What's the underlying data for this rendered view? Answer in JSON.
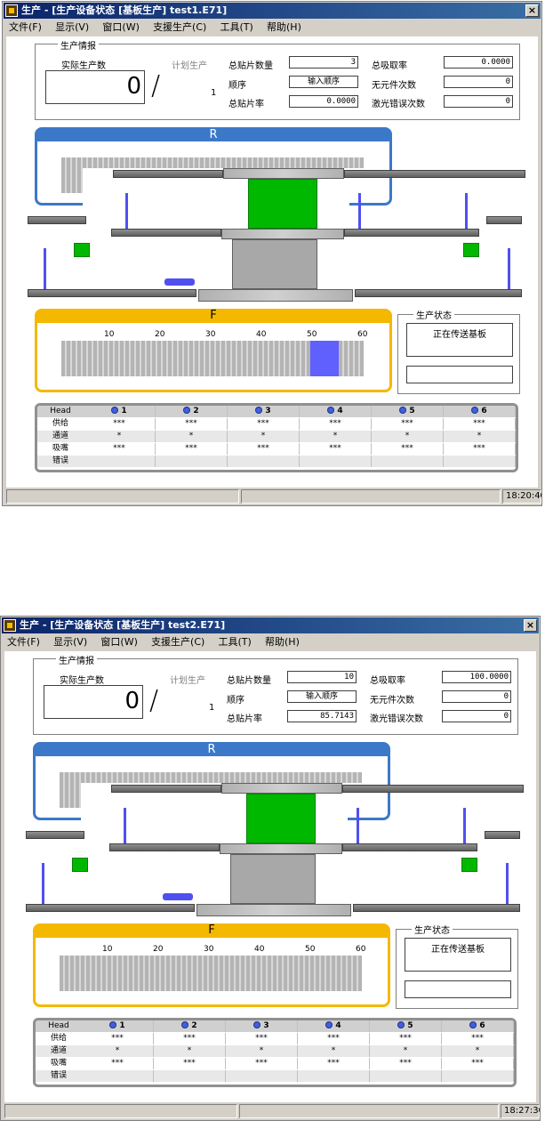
{
  "windows": [
    {
      "title": "生产 - [生产设备状态 [基板生产] test1.E71]",
      "menu": [
        "文件(F)",
        "显示(V)",
        "窗口(W)",
        "支援生产(C)",
        "工具(T)",
        "帮助(H)"
      ],
      "production_info": {
        "group_label": "生产情报",
        "actual_label": "实际生产数",
        "actual_value": "0",
        "plan_label": "计划生产",
        "plan_value": "1",
        "total_mount_label": "总贴片数量",
        "total_mount_value": "3",
        "order_label": "顺序",
        "order_button": "输入顺序",
        "total_rate_label": "总贴片率",
        "total_rate_value": "0.0000",
        "pickup_rate_label": "总吸取率",
        "pickup_rate_value": "0.0000",
        "no_part_label": "无元件次数",
        "no_part_value": "0",
        "laser_err_label": "激光错误次数",
        "laser_err_value": "0"
      },
      "r_panel": {
        "label": "R"
      },
      "f_panel": {
        "label": "F",
        "ticks": [
          "10",
          "20",
          "30",
          "40",
          "50",
          "60"
        ],
        "highlight": "51-54"
      },
      "status": {
        "group_label": "生产状态",
        "message": "正在传送基板"
      },
      "heads": {
        "header": "Head",
        "columns": [
          "1",
          "2",
          "3",
          "4",
          "5",
          "6"
        ],
        "rows": [
          {
            "label": "供给",
            "values": [
              "***",
              "***",
              "***",
              "***",
              "***",
              "***"
            ]
          },
          {
            "label": "通道",
            "values": [
              "*",
              "*",
              "*",
              "*",
              "*",
              "*"
            ]
          },
          {
            "label": "吸嘴",
            "values": [
              "***",
              "***",
              "***",
              "***",
              "***",
              "***"
            ]
          },
          {
            "label": "错误",
            "values": [
              "",
              "",
              "",
              "",
              "",
              ""
            ]
          }
        ]
      },
      "statusbar_time": "18:20:40"
    },
    {
      "title": "生产 - [生产设备状态 [基板生产] test2.E71]",
      "menu": [
        "文件(F)",
        "显示(V)",
        "窗口(W)",
        "支援生产(C)",
        "工具(T)",
        "帮助(H)"
      ],
      "production_info": {
        "group_label": "生产情报",
        "actual_label": "实际生产数",
        "actual_value": "0",
        "plan_label": "计划生产",
        "plan_value": "1",
        "total_mount_label": "总贴片数量",
        "total_mount_value": "10",
        "order_label": "顺序",
        "order_button": "输入顺序",
        "total_rate_label": "总贴片率",
        "total_rate_value": "85.7143",
        "pickup_rate_label": "总吸取率",
        "pickup_rate_value": "100.0000",
        "no_part_label": "无元件次数",
        "no_part_value": "0",
        "laser_err_label": "激光错误次数",
        "laser_err_value": "0"
      },
      "r_panel": {
        "label": "R"
      },
      "f_panel": {
        "label": "F",
        "ticks": [
          "10",
          "20",
          "30",
          "40",
          "50",
          "60"
        ],
        "highlight": ""
      },
      "status": {
        "group_label": "生产状态",
        "message": "正在传送基板"
      },
      "heads": {
        "header": "Head",
        "columns": [
          "1",
          "2",
          "3",
          "4",
          "5",
          "6"
        ],
        "rows": [
          {
            "label": "供给",
            "values": [
              "***",
              "***",
              "***",
              "***",
              "***",
              "***"
            ]
          },
          {
            "label": "通道",
            "values": [
              "*",
              "*",
              "*",
              "*",
              "*",
              "*"
            ]
          },
          {
            "label": "吸嘴",
            "values": [
              "***",
              "***",
              "***",
              "***",
              "***",
              "***"
            ]
          },
          {
            "label": "错误",
            "values": [
              "",
              "",
              "",
              "",
              "",
              ""
            ]
          }
        ]
      },
      "statusbar_time": "18:27:30"
    }
  ]
}
